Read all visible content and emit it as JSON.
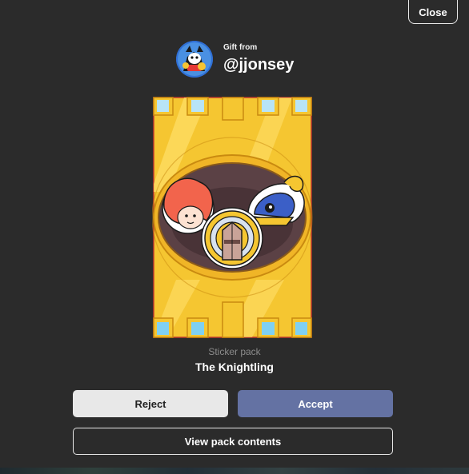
{
  "close_label": "Close",
  "sender": {
    "gift_label": "Gift from",
    "username": "@jjonsey",
    "avatar_icon": "user-avatar-character"
  },
  "pack": {
    "type_label": "Sticker pack",
    "name": "The Knightling",
    "art_icon": "knightling-sticker-pack-art"
  },
  "actions": {
    "reject_label": "Reject",
    "accept_label": "Accept",
    "view_label": "View pack contents"
  },
  "colors": {
    "background": "#2b2b2b",
    "accept": "#6472a3",
    "reject": "#e8e8e8",
    "pack_gold": "#f5c631"
  }
}
